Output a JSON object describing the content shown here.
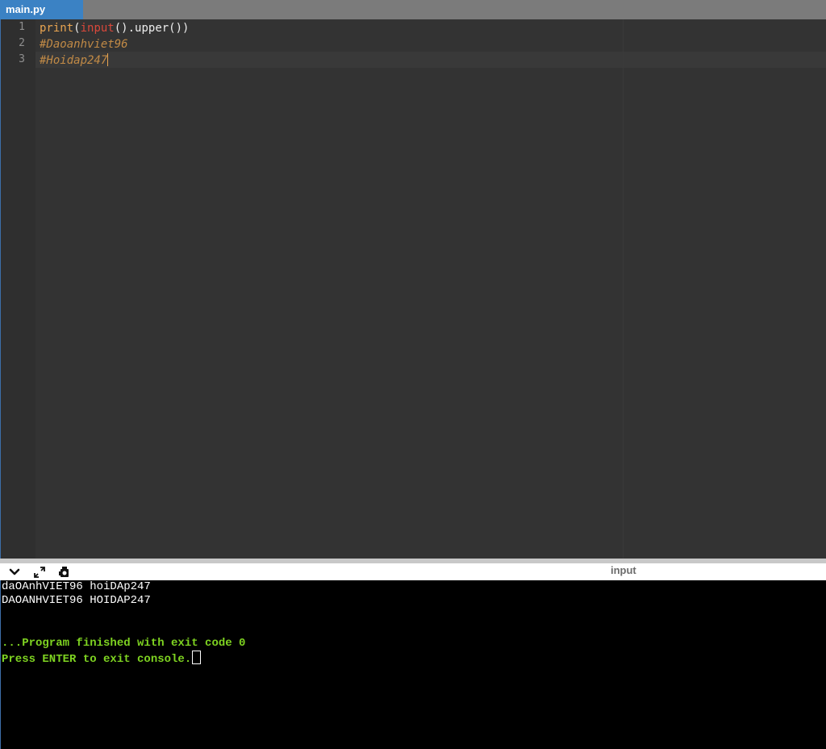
{
  "tabs": [
    {
      "label": "main.py",
      "active": true
    }
  ],
  "editor": {
    "line_numbers": [
      "1",
      "2",
      "3"
    ],
    "lines": [
      {
        "tokens": {
          "t1": "print",
          "t2": "(",
          "t3": "input",
          "t4": "().upper())"
        }
      },
      {
        "text": "#Daoanhviet96"
      },
      {
        "text": "#Hoidap247"
      }
    ]
  },
  "console_toolbar": {
    "icons": [
      "chevron-down-icon",
      "expand-icon",
      "settings-icon"
    ],
    "input_label": "input"
  },
  "console": {
    "lines": [
      "daOAnhVIET96 hoiDAp247",
      "DAOANHVIET96 HOIDAP247",
      "",
      "",
      "...Program finished with exit code 0",
      "Press ENTER to exit console."
    ]
  },
  "colors": {
    "tab_active": "#3b82c4",
    "tabbar": "#7b7b7b",
    "editor_bg": "#333333",
    "console_bg": "#000000",
    "console_success": "#7ed321"
  }
}
